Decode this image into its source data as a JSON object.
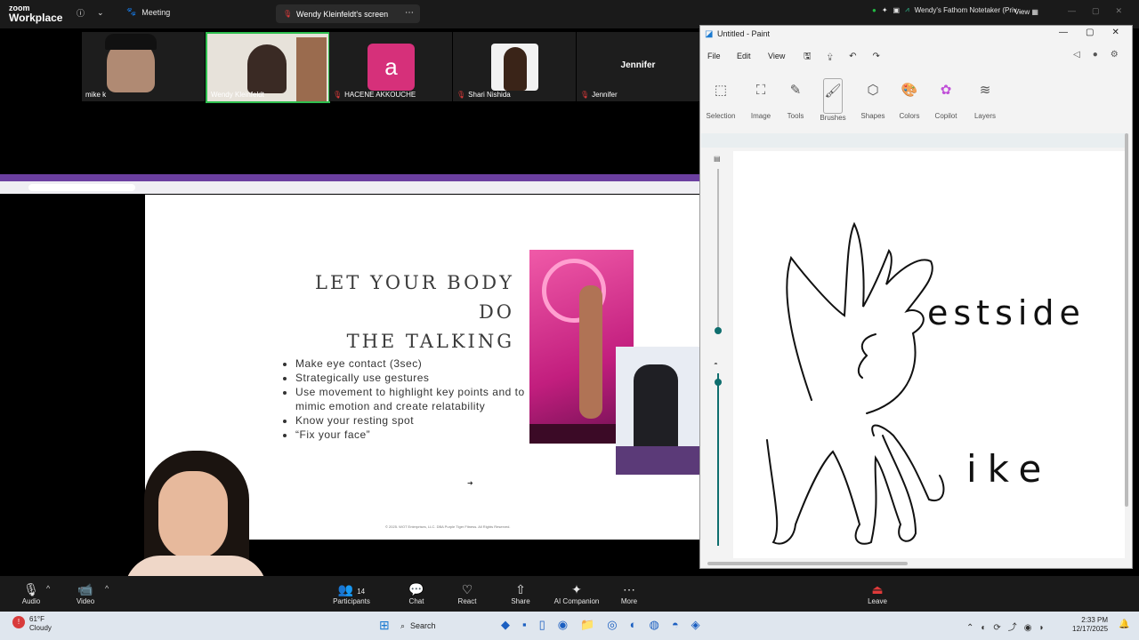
{
  "zoom": {
    "logo_line1": "zoom",
    "logo_line2": "Workplace",
    "meeting_label": "Meeting",
    "screen_label": "Wendy Kleinfeldt's screen",
    "notetaker_label": "Wendy's Fathom Notetaker (Priv...",
    "view_label": "View",
    "participants": [
      {
        "name": "mike k",
        "muted": false
      },
      {
        "name": "Wendy Kleinfeldt",
        "muted": false,
        "active": true
      },
      {
        "name": "HACENE AKKOUCHE",
        "avatar_letter": "a",
        "muted": true
      },
      {
        "name": "Shari Nishida",
        "muted": true
      },
      {
        "name": "Jennifer",
        "header": "Jennifer",
        "muted": true
      }
    ],
    "toolbar": {
      "audio": "Audio",
      "video": "Video",
      "participants": "Participants",
      "participants_count": "14",
      "chat": "Chat",
      "react": "React",
      "share": "Share",
      "ai_companion": "AI Companion",
      "more": "More",
      "leave": "Leave"
    }
  },
  "slide": {
    "title_line1": "LET YOUR BODY DO",
    "title_line2": "THE TALKING",
    "bullets": [
      "Make eye contact (3sec)",
      "Strategically use gestures",
      "Use movement to highlight key points and to mimic emotion and create relatability",
      "Know your resting spot",
      "“Fix your face”"
    ],
    "footer": "© 2025. WOT Enterprises, LLC. DBA Purple Tiger Fitness. All Rights Reserved."
  },
  "paint": {
    "title": "Untitled - Paint",
    "menu": [
      "File",
      "Edit",
      "View"
    ],
    "tools": [
      "Selection",
      "Image",
      "Tools",
      "Brushes",
      "Shapes",
      "Colors",
      "Copilot",
      "Layers"
    ],
    "canvas_text_1": "estside",
    "canvas_text_2": "ike"
  },
  "taskbar": {
    "weather_temp": "61°F",
    "weather_desc": "Cloudy",
    "search": "Search",
    "time": "2:33 PM",
    "date": "12/17/2025"
  },
  "colors": {
    "zoom_bg": "#1a1a1a",
    "active_speaker": "#2fbf4f",
    "avatar_pink": "#d6307a",
    "paint_accent": "#0f6e6e",
    "taskbar_bg": "#dfe6ee"
  }
}
